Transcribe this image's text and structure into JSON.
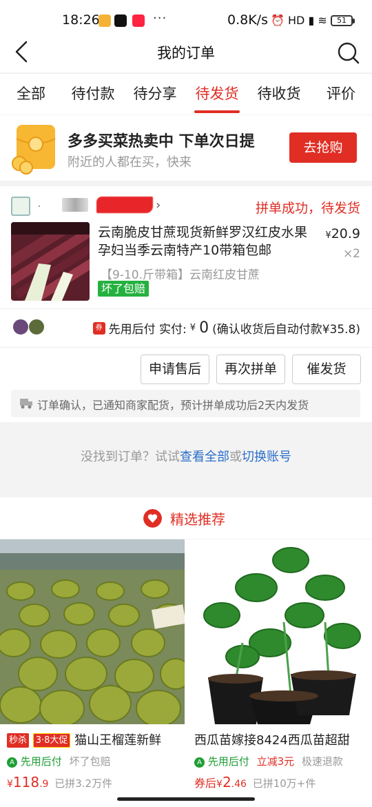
{
  "status_bar": {
    "time": "18:26",
    "more": "···",
    "network_speed": "0.8K/s",
    "status_icons": "⏰ HD ▮ ≋",
    "battery": "51"
  },
  "header": {
    "title": "我的订单"
  },
  "tabs": [
    {
      "label": "全部",
      "active": false
    },
    {
      "label": "待付款",
      "active": false
    },
    {
      "label": "待分享",
      "active": false
    },
    {
      "label": "待发货",
      "active": true
    },
    {
      "label": "待收货",
      "active": false
    },
    {
      "label": "评价",
      "active": false
    }
  ],
  "promo": {
    "title": "多多买菜热卖中 下单次日提",
    "subtitle": "附近的人都在买，快来",
    "button": "去抢购"
  },
  "order": {
    "shop_prefix": ".",
    "status": "拼单成功，待发货",
    "product_title": "云南脆皮甘蔗现货新鲜罗汉红皮水果孕妇当季云南特产10带箱包邮",
    "price_symbol": "¥",
    "price": "20.9",
    "quantity": "×2",
    "spec": "【9-10.斤带箱】云南红皮甘蔗",
    "badge": "坏了包赔",
    "pay_tag": "券",
    "pay_label": "先用后付 实付:",
    "pay_symbol": "¥",
    "pay_amount": "0",
    "pay_note": "(确认收货后自动付款¥35.8)",
    "buttons": [
      "申请售后",
      "再次拼单",
      "催发货"
    ],
    "notice": "订单确认，已通知商家配货，预计拼单成功后2天内发货"
  },
  "notfound": {
    "text": "没找到订单？试试",
    "link1": "查看全部",
    "or": "或",
    "link2": "切换账号"
  },
  "recommend": {
    "title": "精选推荐"
  },
  "products": [
    {
      "tag1": "秒杀",
      "tag2": "3·8大促",
      "title": "猫山王榴莲新鲜",
      "meta_green": "先用后付",
      "meta_extra": "坏了包赔",
      "price_prefix": "",
      "currency": "¥",
      "price": "118",
      "price_decimal": ".9",
      "sold": "已拼3.2万件"
    },
    {
      "title": "西瓜苗嫁接8424西瓜苗超甜",
      "meta_green": "先用后付",
      "meta_red": "立减3元",
      "meta_extra": "极速退款",
      "price_prefix": "券后",
      "currency": "¥",
      "price": "2",
      "price_decimal": ".46",
      "sold": "已拼10万+件"
    }
  ],
  "colors": {
    "accent": "#e02e24",
    "link": "#2b6ec9",
    "green": "#25b13f"
  }
}
